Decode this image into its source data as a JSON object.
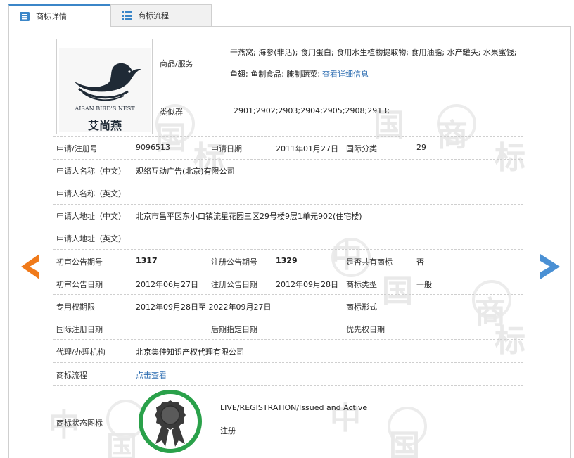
{
  "tabs": [
    {
      "label": "商标详情",
      "active": true
    },
    {
      "label": "商标流程",
      "active": false
    }
  ],
  "watermark": [
    "中",
    "国",
    "商",
    "标"
  ],
  "logo": {
    "brand_en": "AISAN BIRD'S NEST",
    "brand_cn": "艾尚燕"
  },
  "goods": {
    "label": "商品/服务",
    "line1": "干燕窝; 海参(非活); 食用蛋白; 食用水生植物提取物; 食用油脂; 水产罐头; 水果蜜饯;",
    "line2": "鱼翅; 鱼制食品; 腌制蔬菜;",
    "detail_link": "查看详细信息"
  },
  "similar_group": {
    "label": "类似群",
    "value": "2901;2902;2903;2904;2905;2908;2913;"
  },
  "fields": {
    "reg_no_label": "申请/注册号",
    "reg_no": "9096513",
    "app_date_label": "申请日期",
    "app_date": "2011年01月27日",
    "intl_class_label": "国际分类",
    "intl_class": "29",
    "applicant_cn_label": "申请人名称（中文）",
    "applicant_cn": "观络互动广告(北京)有限公司",
    "applicant_en_label": "申请人名称（英文）",
    "applicant_en": "",
    "address_cn_label": "申请人地址（中文）",
    "address_cn": "北京市昌平区东小口镇流星花园三区29号楼9层1单元902(住宅楼)",
    "address_en_label": "申请人地址（英文）",
    "address_en": "",
    "prelim_issue_label": "初审公告期号",
    "prelim_issue": "1317",
    "reg_issue_label": "注册公告期号",
    "reg_issue": "1329",
    "shared_label": "是否共有商标",
    "shared": "否",
    "prelim_date_label": "初审公告日期",
    "prelim_date": "2012年06月27日",
    "reg_date_label": "注册公告日期",
    "reg_date": "2012年09月28日",
    "tm_type_label": "商标类型",
    "tm_type": "一般",
    "exclusive_label": "专用权期限",
    "exclusive": "2012年09月28日至 2022年09月27日",
    "tm_form_label": "商标形式",
    "tm_form": "",
    "intl_reg_date_label": "国际注册日期",
    "intl_reg_date": "",
    "later_date_label": "后期指定日期",
    "later_date": "",
    "priority_date_label": "优先权日期",
    "priority_date": "",
    "agent_label": "代理/办理机构",
    "agent": "北京集佳知识产权代理有限公司",
    "flow_label": "商标流程",
    "flow_link": "点击查看",
    "status_icon_label": "商标状态图标",
    "status_en": "LIVE/REGISTRATION/Issued and Active",
    "status_cn": "注册"
  },
  "colors": {
    "arrow_left": "#f07a1a",
    "arrow_right": "#4a90d4",
    "badge_ring": "#2aa14a",
    "link": "#2a6bb0"
  },
  "icons": [
    "list-icon",
    "chevron-left-icon",
    "chevron-right-icon",
    "award-ribbon-icon"
  ]
}
